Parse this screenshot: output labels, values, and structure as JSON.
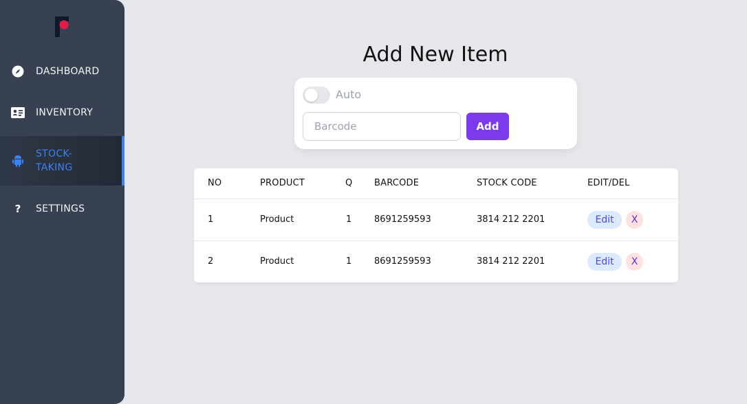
{
  "sidebar": {
    "logo_icon": "brand-logo",
    "items": [
      {
        "label": "DASHBOARD",
        "icon": "compass-icon"
      },
      {
        "label": "INVENTORY",
        "icon": "id-card-icon"
      },
      {
        "label": "STOCK-TAKING",
        "icon": "android-icon",
        "active": true
      },
      {
        "label": "SETTINGS",
        "icon": "question-icon"
      }
    ]
  },
  "main": {
    "title": "Add New Item",
    "form": {
      "toggle_label": "Auto",
      "toggle_on": false,
      "barcode_placeholder": "Barcode",
      "barcode_value": "",
      "add_label": "Add"
    },
    "table": {
      "headers": [
        "NO",
        "PRODUCT",
        "Q",
        "BARCODE",
        "STOCK CODE",
        "EDIT/DEL"
      ],
      "rows": [
        {
          "no": "1",
          "product": "Product",
          "q": "1",
          "barcode": "8691259593",
          "stock_code": "3814 212 2201",
          "edit_label": "Edit",
          "del_label": "X"
        },
        {
          "no": "2",
          "product": "Product",
          "q": "1",
          "barcode": "8691259593",
          "stock_code": "3814 212 2201",
          "edit_label": "Edit",
          "del_label": "X"
        }
      ]
    }
  },
  "colors": {
    "sidebar_bg": "#374151",
    "active_accent": "#3b82f6",
    "primary_button": "#7c3aed",
    "logo_accent": "#e11d48"
  }
}
